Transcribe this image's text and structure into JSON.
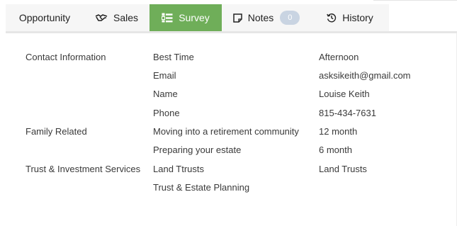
{
  "tabs": [
    {
      "label": "Opportunity",
      "icon": "none"
    },
    {
      "label": "Sales",
      "icon": "handshake-icon"
    },
    {
      "label": "Survey",
      "icon": "survey-icon",
      "active": true
    },
    {
      "label": "Notes",
      "icon": "note-icon",
      "badge": "0"
    },
    {
      "label": "History",
      "icon": "history-icon"
    }
  ],
  "colors": {
    "active_tab": "#6fae59",
    "badge": "#c9d4e2"
  },
  "survey": {
    "rows": [
      {
        "category": "Contact Information",
        "question": "Best Time",
        "answer": "Afternoon"
      },
      {
        "category": "",
        "question": "Email",
        "answer": "asksikeith@gmail.com"
      },
      {
        "category": "",
        "question": "Name",
        "answer": "Louise Keith"
      },
      {
        "category": "",
        "question": "Phone",
        "answer": "815-434-7631"
      },
      {
        "category": "Family Related",
        "question": "Moving into a retirement community",
        "answer": "12 month"
      },
      {
        "category": "",
        "question": "Preparing your estate",
        "answer": "6 month"
      },
      {
        "category": "Trust & Investment Services",
        "question": "Land Ttrusts",
        "answer": "Land Trusts"
      },
      {
        "category": "",
        "question": "Trust & Estate Planning",
        "answer": ""
      }
    ]
  }
}
